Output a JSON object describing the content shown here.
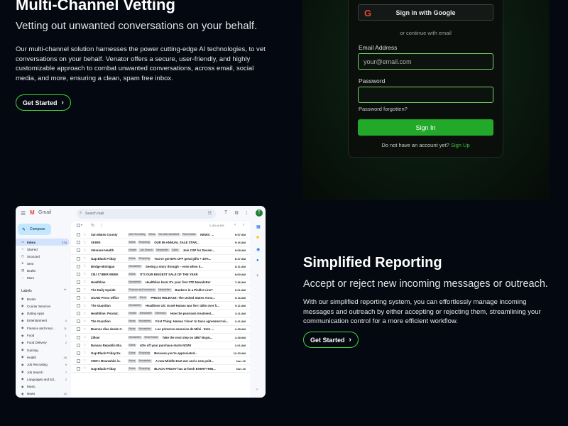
{
  "hero": {
    "title": "Multi-Channel Vetting",
    "subtitle": "Vetting out unwanted conversations on your behalf.",
    "body": "Our multi-channel solution harnesses the power cutting-edge AI technologies, to vet conversations on your behalf. Venator offers a secure, user-friendly, and highly customizable approach to combat unwanted conversations, across email, social media, and more, ensuring a clean, spam free inbox.",
    "cta_label": "Get Started"
  },
  "login": {
    "google_label": "Sign in with Google",
    "or_text": "or continue with email",
    "email_label": "Email Address",
    "email_placeholder": "your@email.com",
    "password_label": "Password",
    "password_forgot": "Password forgotten?",
    "signin_label": "Sign In",
    "no_account_text": "Do not have an account yet?",
    "signup_label": "Sign Up"
  },
  "gmail": {
    "brand": "Gmail",
    "search_placeholder": "Search mail",
    "avatar_letter": "T",
    "compose_label": "Compose",
    "pagination": "1–50 of 401",
    "labels_heading": "Labels",
    "nav": [
      {
        "label": "Inbox",
        "count": "174",
        "icon": "inbox-icon"
      },
      {
        "label": "Starred",
        "count": "",
        "icon": "star-icon"
      },
      {
        "label": "Snoozed",
        "count": "",
        "icon": "clock-icon"
      },
      {
        "label": "Sent",
        "count": "",
        "icon": "send-icon"
      },
      {
        "label": "Drafts",
        "count": "",
        "icon": "draft-icon"
      },
      {
        "label": "More",
        "count": "",
        "icon": "chevron-down-icon"
      }
    ],
    "labels": [
      {
        "label": "Books",
        "count": ""
      },
      {
        "label": "Courier Services",
        "count": ""
      },
      {
        "label": "Dating Apps",
        "count": ""
      },
      {
        "label": "Entertainment",
        "count": "4"
      },
      {
        "label": "Finance and Insur...",
        "count": "11"
      },
      {
        "label": "Food",
        "count": "1"
      },
      {
        "label": "Food Delivery",
        "count": "2"
      },
      {
        "label": "Gaming",
        "count": ""
      },
      {
        "label": "Health",
        "count": "45"
      },
      {
        "label": "Job Recruiting",
        "count": "9"
      },
      {
        "label": "Job Search",
        "count": "7"
      },
      {
        "label": "Languages and Ed...",
        "count": "2"
      },
      {
        "label": "Music",
        "count": ""
      },
      {
        "label": "News",
        "count": "10"
      }
    ],
    "emails": [
      {
        "sender": "San Mateo County",
        "tags": [
          "Job Recruiting",
          "News",
          "No label identified",
          "Real Estate"
        ],
        "subject": "NEWS: ...",
        "date": "9:57 AM"
      },
      {
        "sender": "SKIMS",
        "tags": [
          "Sales",
          "Shopping"
        ],
        "subject": "OUR BI-ANNUAL SALE STAR...",
        "date": "9:16 AM"
      },
      {
        "sender": "Veterans Health",
        "tags": [
          "Health",
          "Job Search",
          "Newsletter",
          "Sales"
        ],
        "subject": "Join CSP for Decem...",
        "date": "9:05 AM"
      },
      {
        "sender": "Gap Black Friday",
        "tags": [
          "Sales",
          "Shopping"
        ],
        "subject": "You've got 60% OFF great gifts + 40%...",
        "date": "8:47 AM"
      },
      {
        "sender": "Bridge Michigan",
        "tags": [
          "Newsletter"
        ],
        "subject": "Seeing a story through – even when it...",
        "date": "8:11 AM"
      },
      {
        "sender": "CBJ CYBER WEEK",
        "tags": [
          "Sales"
        ],
        "subject": "IT'S OUR BIGGEST SALE OF THE YEAR",
        "date": "8:00 AM"
      },
      {
        "sender": "Healthline",
        "tags": [
          "Newsletter"
        ],
        "subject": "Healthline here! It's your first 2TD Newsletter",
        "date": "7:36 AM"
      },
      {
        "sender": "The Daily Upside",
        "tags": [
          "Finance and Insurance",
          "Newsletter"
        ],
        "subject": "Bankers in a Pickle! Line?",
        "date": "6:01 AM"
      },
      {
        "sender": "USAID Press Office",
        "tags": [
          "Health",
          "News"
        ],
        "subject": "PRESS RELEASE: The United States Anno...",
        "date": "5:16 AM"
      },
      {
        "sender": "The Guardian",
        "tags": [
          "Newsletter"
        ],
        "subject": "Headlines US: Israel-Hamas war live: talks over h...",
        "date": "5:11 AM"
      },
      {
        "sender": "Healthline: Psoriat.",
        "tags": [
          "Health",
          "Newsletter",
          "Wellness"
        ],
        "subject": "How the psoriasis treatment...",
        "date": "3:11 AM"
      },
      {
        "sender": "The Guardian",
        "tags": [
          "News",
          "Newsletter"
        ],
        "subject": "First Thing: Hamas 'close' to truce agreement wi...",
        "date": "2:41 AM"
      },
      {
        "sender": "Buenos días desde C.",
        "tags": [
          "News",
          "Newsletter"
        ],
        "subject": "Los primeros anuncios de Milei · Esto ...",
        "date": "2:35 AM"
      },
      {
        "sender": "Zillow",
        "tags": [
          "Newsletter",
          "Real Estate"
        ],
        "subject": "Take the next step on 4867 Bayar...",
        "date": "2:48 AM"
      },
      {
        "sender": "Banana Republic Bla.",
        "tags": [
          "Sales"
        ],
        "subject": "40% off your purchase starts NOW!",
        "date": "1:01 AM"
      },
      {
        "sender": "Gap Black Friday Ex.",
        "tags": [
          "Sales",
          "Shopping"
        ],
        "subject": "Because you're appreciated...",
        "date": "12:33 AM"
      },
      {
        "sender": "CNN's Meanwhile in.",
        "tags": [
          "News",
          "Newsletter"
        ],
        "subject": "A new Middle East war and a new polit...",
        "date": "Nov 20"
      },
      {
        "sender": "Gap Black Friday",
        "tags": [
          "Sales",
          "Shopping"
        ],
        "subject": "BLACK FRIDAY has arrived! EVERYTHIN...",
        "date": "Nov 20"
      }
    ]
  },
  "reporting": {
    "title": "Simplified Reporting",
    "subtitle": "Accept or reject new incoming messages or outreach.",
    "body": "With our simplified reporting system, you can effortlessly manage incoming messages and outreach by either accepting or rejecting them, streamlining your communication control for a more efficient workflow.",
    "cta_label": "Get Started"
  },
  "colors": {
    "accent_green": "#43d43a",
    "signin_green": "#23a929",
    "background": "#040810"
  }
}
